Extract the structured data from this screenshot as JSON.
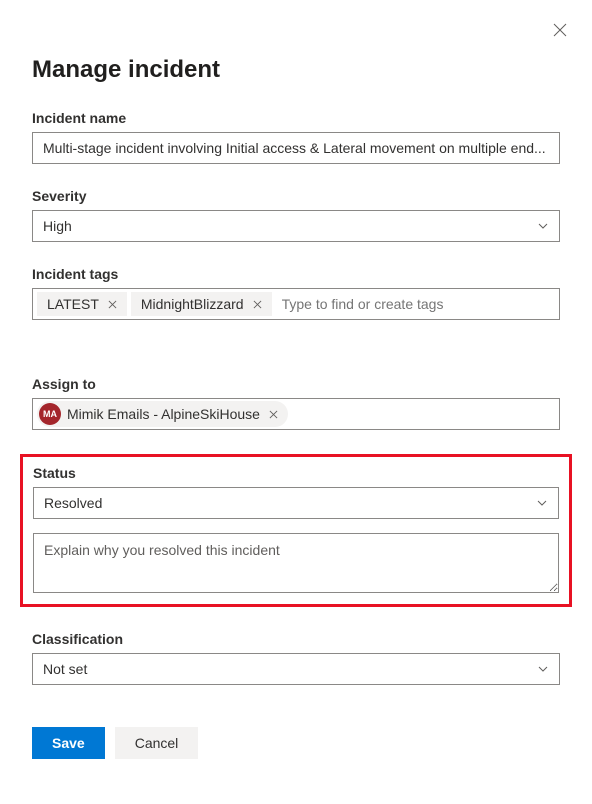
{
  "title": "Manage incident",
  "fields": {
    "incident_name": {
      "label": "Incident name",
      "value": "Multi-stage incident involving Initial access & Lateral movement on multiple end..."
    },
    "severity": {
      "label": "Severity",
      "value": "High"
    },
    "incident_tags": {
      "label": "Incident tags",
      "tags": [
        "LATEST",
        "MidnightBlizzard"
      ],
      "placeholder": "Type to find or create tags"
    },
    "assign_to": {
      "label": "Assign to",
      "assignee": {
        "initials": "MA",
        "name": "Mimik Emails - AlpineSkiHouse"
      }
    },
    "status": {
      "label": "Status",
      "value": "Resolved",
      "explain_placeholder": "Explain why you resolved this incident"
    },
    "classification": {
      "label": "Classification",
      "value": "Not set"
    }
  },
  "actions": {
    "save": "Save",
    "cancel": "Cancel"
  }
}
